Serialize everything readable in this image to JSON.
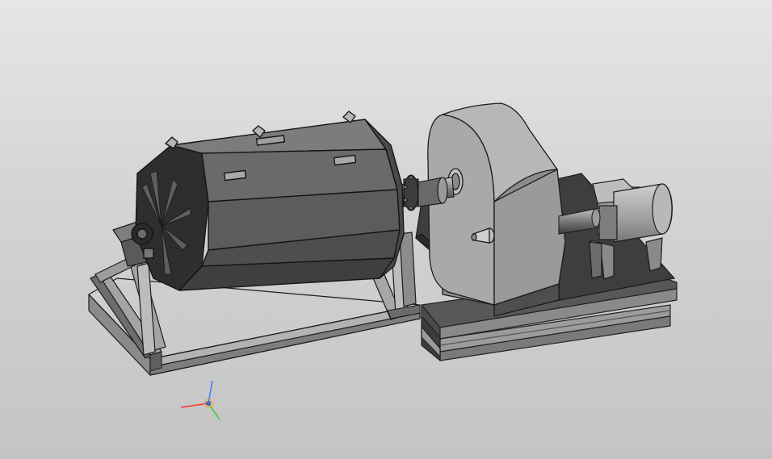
{
  "viewport": {
    "background_top": "#e6e6e6",
    "background_bottom": "#c4c4c4"
  },
  "model": {
    "description_icon": "ball-mill-assembly",
    "parts": [
      "octagonal-drum",
      "drum-support-frame",
      "coupling",
      "gearbox",
      "motor",
      "drive-base-frame"
    ]
  },
  "triad": {
    "x_color": "#ff3333",
    "y_color": "#33cc33",
    "z_color": "#3377ff"
  }
}
